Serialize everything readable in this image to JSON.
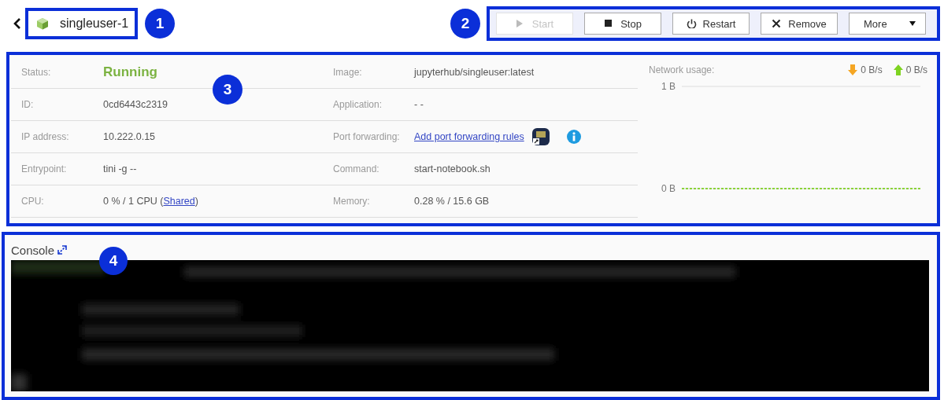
{
  "header": {
    "title": "singleuser-1",
    "callout": "1"
  },
  "toolbar": {
    "callout": "2",
    "buttons": [
      {
        "label": "Start",
        "kind": "play",
        "disabled": true
      },
      {
        "label": "Stop",
        "kind": "stop",
        "disabled": false
      },
      {
        "label": "Restart",
        "kind": "power",
        "disabled": false
      },
      {
        "label": "Remove",
        "kind": "close",
        "disabled": false
      },
      {
        "label": "More",
        "kind": "dropdown",
        "disabled": false
      }
    ]
  },
  "details": {
    "callout": "3",
    "columns": [
      [
        {
          "label": "Status:",
          "kind": "status",
          "parts": [
            {
              "text": "Running"
            }
          ]
        },
        {
          "label": "ID:",
          "kind": "text",
          "parts": [
            {
              "text": "0cd6443c2319"
            }
          ]
        },
        {
          "label": "IP address:",
          "kind": "text",
          "parts": [
            {
              "text": "10.222.0.15"
            }
          ]
        },
        {
          "label": "Entrypoint:",
          "kind": "text",
          "parts": [
            {
              "text": "tini -g --"
            }
          ]
        },
        {
          "label": "CPU:",
          "kind": "text",
          "parts": [
            {
              "text": "0 % / 1 CPU ("
            },
            {
              "text": "Shared",
              "kind": "link"
            },
            {
              "text": ")"
            }
          ]
        }
      ],
      [
        {
          "label": "Image:",
          "kind": "text",
          "parts": [
            {
              "text": "jupyterhub/singleuser:latest"
            }
          ]
        },
        {
          "label": "Application:",
          "kind": "text",
          "parts": [
            {
              "text": "- -"
            }
          ]
        },
        {
          "label": "Port forwarding:",
          "kind": "port",
          "parts": [
            {
              "text": "Add port forwarding rules",
              "kind": "link"
            }
          ]
        },
        {
          "label": "Command:",
          "kind": "text",
          "parts": [
            {
              "text": "start-notebook.sh"
            }
          ]
        },
        {
          "label": "Memory:",
          "kind": "text",
          "parts": [
            {
              "text": "0.28 % / 15.6 GB"
            }
          ]
        }
      ]
    ],
    "network": {
      "label": "Network usage:",
      "download": "0 B/s",
      "upload": "0 B/s",
      "chart_data": {
        "type": "line",
        "ylim": [
          0,
          1
        ],
        "yticks": [
          {
            "value": 1,
            "label": "1 B"
          },
          {
            "value": 0,
            "label": "0 B"
          }
        ],
        "series": [
          {
            "color": "#8bd33a",
            "line_style": "dashed",
            "values": [
              0,
              0,
              0,
              0,
              0,
              0,
              0,
              0,
              0,
              0,
              0,
              0,
              0,
              0,
              0,
              0,
              0,
              0,
              0,
              0,
              0,
              0,
              0,
              0,
              0,
              0,
              0,
              0,
              0,
              0,
              0,
              0,
              0,
              0,
              0,
              0,
              0,
              0,
              0,
              0
            ]
          }
        ]
      }
    }
  },
  "console": {
    "title": "Console",
    "callout": "4"
  }
}
